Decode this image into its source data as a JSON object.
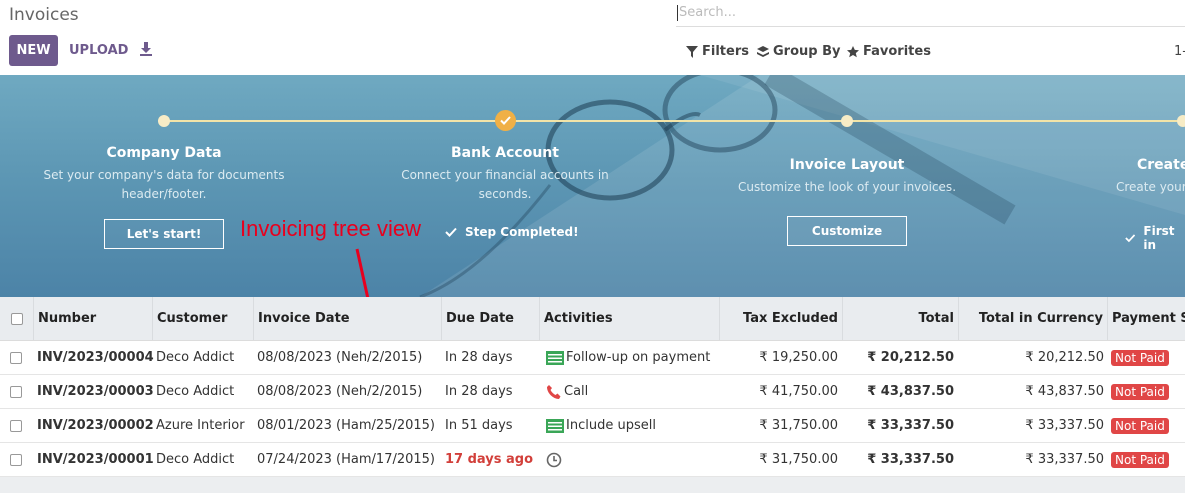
{
  "header": {
    "title": "Invoices",
    "new_label": "NEW",
    "upload_label": "UPLOAD",
    "search_placeholder": "Search...",
    "filters_label": "Filters",
    "groupby_label": "Group By",
    "favorites_label": "Favorites",
    "pager_label": "1-"
  },
  "banner": {
    "steps": [
      {
        "title": "Company Data",
        "desc_lines": [
          "Set your company's data for documents",
          "header/footer."
        ],
        "action": "Let's start!"
      },
      {
        "title": "Bank Account",
        "desc_lines": [
          "Connect your financial accounts in",
          "seconds."
        ],
        "action": "Step Completed!"
      },
      {
        "title": "Invoice Layout",
        "desc_lines": [
          "Customize the look of your invoices."
        ],
        "action": "Customize"
      },
      {
        "title": "Create",
        "desc_lines": [
          "Create your"
        ],
        "action": "First in"
      }
    ],
    "colors": {
      "track": "#f2e4a8",
      "done_dot": "#f0b046"
    }
  },
  "annotation": {
    "text": "Invoicing tree view",
    "color": "#e8001e"
  },
  "table": {
    "columns": [
      "Number",
      "Customer",
      "Invoice Date",
      "Due Date",
      "Activities",
      "Tax Excluded",
      "Total",
      "Total in Currency",
      "Payment Sta"
    ],
    "rows": [
      {
        "number": "INV/2023/00004",
        "customer": "Deco Addict",
        "invoice_date": "08/08/2023 (Neh/2/2015)",
        "due": "In 28 days",
        "due_late": false,
        "activity_icon": "phone-list-icon",
        "activity": "Follow-up on payment",
        "tax_excluded": "₹ 19,250.00",
        "total": "₹ 20,212.50",
        "total_currency": "₹ 20,212.50",
        "status": "Not Paid"
      },
      {
        "number": "INV/2023/00003",
        "customer": "Deco Addict",
        "invoice_date": "08/08/2023 (Neh/2/2015)",
        "due": "In 28 days",
        "due_late": false,
        "activity_icon": "phone-icon",
        "activity": "Call",
        "tax_excluded": "₹ 41,750.00",
        "total": "₹ 43,837.50",
        "total_currency": "₹ 43,837.50",
        "status": "Not Paid"
      },
      {
        "number": "INV/2023/00002",
        "customer": "Azure Interior",
        "invoice_date": "08/01/2023 (Ham/25/2015)",
        "due": "In 51 days",
        "due_late": false,
        "activity_icon": "list-icon",
        "activity": "Include upsell",
        "tax_excluded": "₹ 31,750.00",
        "total": "₹ 33,337.50",
        "total_currency": "₹ 33,337.50",
        "status": "Not Paid"
      },
      {
        "number": "INV/2023/00001",
        "customer": "Deco Addict",
        "invoice_date": "07/24/2023 (Ham/17/2015)",
        "due": "17 days ago",
        "due_late": true,
        "activity_icon": "clock-icon",
        "activity": "",
        "tax_excluded": "₹ 31,750.00",
        "total": "₹ 33,337.50",
        "total_currency": "₹ 33,337.50",
        "status": "Not Paid"
      }
    ],
    "colors": {
      "late": "#d23f3a",
      "badge": "#e04646",
      "header_bg": "#e9ecef"
    }
  }
}
